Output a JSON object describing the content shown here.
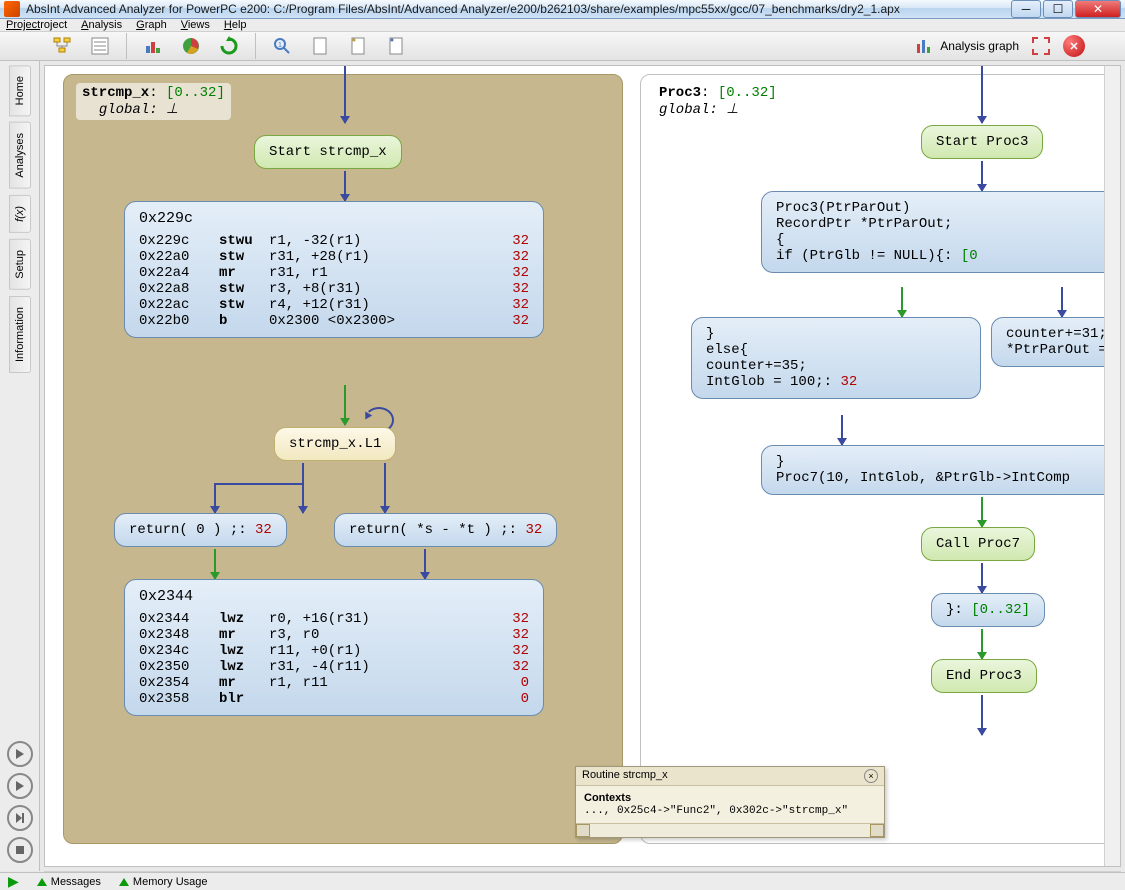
{
  "title": "AbsInt Advanced Analyzer for PowerPC e200: C:/Program Files/AbsInt/Advanced Analyzer/e200/b262103/share/examples/mpc55xx/gcc/07_benchmarks/dry2_1.apx",
  "menus": [
    "Project",
    "Analysis",
    "Graph",
    "Views",
    "Help"
  ],
  "menu_underline_idx": [
    0,
    0,
    0,
    0,
    0
  ],
  "toolbar_right_label": "Analysis graph",
  "left_tabs": [
    "Home",
    "Analyses",
    "f(x)",
    "Setup",
    "Information"
  ],
  "left_panel": {
    "title": "strcmp_x",
    "range": "[0..32]",
    "global_label": "global",
    "global_val": "⊥",
    "start_node": "Start strcmp_x",
    "block1": {
      "addr": "0x229c",
      "rows": [
        {
          "a": "0x229c",
          "m": "stwu",
          "o": "r1, -32(r1)",
          "c": "32"
        },
        {
          "a": "0x22a0",
          "m": "stw",
          "o": "r31, +28(r1)",
          "c": "32"
        },
        {
          "a": "0x22a4",
          "m": "mr",
          "o": "r31, r1",
          "c": "32"
        },
        {
          "a": "0x22a8",
          "m": "stw",
          "o": "r3, +8(r31)",
          "c": "32"
        },
        {
          "a": "0x22ac",
          "m": "stw",
          "o": "r4, +12(r31)",
          "c": "32"
        },
        {
          "a": "0x22b0",
          "m": "b",
          "o": "0x2300 <0x2300>",
          "c": "32"
        }
      ]
    },
    "label_node": "strcmp_x.L1",
    "ret0": {
      "txt": "return( 0 ) ;",
      "cnt": "32"
    },
    "ret1": {
      "txt": "return( *s - *t ) ;",
      "cnt": "32"
    },
    "block2": {
      "addr": "0x2344",
      "rows": [
        {
          "a": "0x2344",
          "m": "lwz",
          "o": "r0, +16(r31)",
          "c": "32"
        },
        {
          "a": "0x2348",
          "m": "mr",
          "o": "r3, r0",
          "c": "32"
        },
        {
          "a": "0x234c",
          "m": "lwz",
          "o": "r11, +0(r1)",
          "c": "32"
        },
        {
          "a": "0x2350",
          "m": "lwz",
          "o": "r31, -4(r11)",
          "c": "32"
        },
        {
          "a": "0x2354",
          "m": "mr",
          "o": "r1, r11",
          "c": "0"
        },
        {
          "a": "0x2358",
          "m": "blr",
          "o": "",
          "c": "0"
        }
      ]
    }
  },
  "right_panel": {
    "title": "Proc3",
    "range": "[0..32]",
    "global_label": "global",
    "global_val": "⊥",
    "start_node": "Start Proc3",
    "block1": {
      "l1": "Proc3(PtrParOut)",
      "l2": "RecordPtr       *PtrParOut;",
      "l3": "{",
      "l4": "        if (PtrGlb != NULL){",
      "l4cnt": "[0"
    },
    "else_block": {
      "l1": "}",
      "l2": "else{",
      "l3": "        counter+=35;",
      "l4": "        IntGlob = 100;",
      "cnt": "32"
    },
    "count_block": {
      "l1": "counter+=31;",
      "l2": "*PtrParOut ="
    },
    "proc7_block": {
      "l1": "}",
      "l2": "Proc7(10, IntGlob, &PtrGlb->IntComp"
    },
    "call_node": "Call Proc7",
    "close_node": {
      "txt": "}",
      "cnt": "[0..32]"
    },
    "end_node": "End Proc3"
  },
  "tooltip": {
    "title": "Routine strcmp_x",
    "section": "Contexts",
    "line": "..., 0x25c4->\"Func2\", 0x302c->\"strcmp_x\""
  },
  "statusbar": {
    "messages": "Messages",
    "memory": "Memory Usage"
  }
}
